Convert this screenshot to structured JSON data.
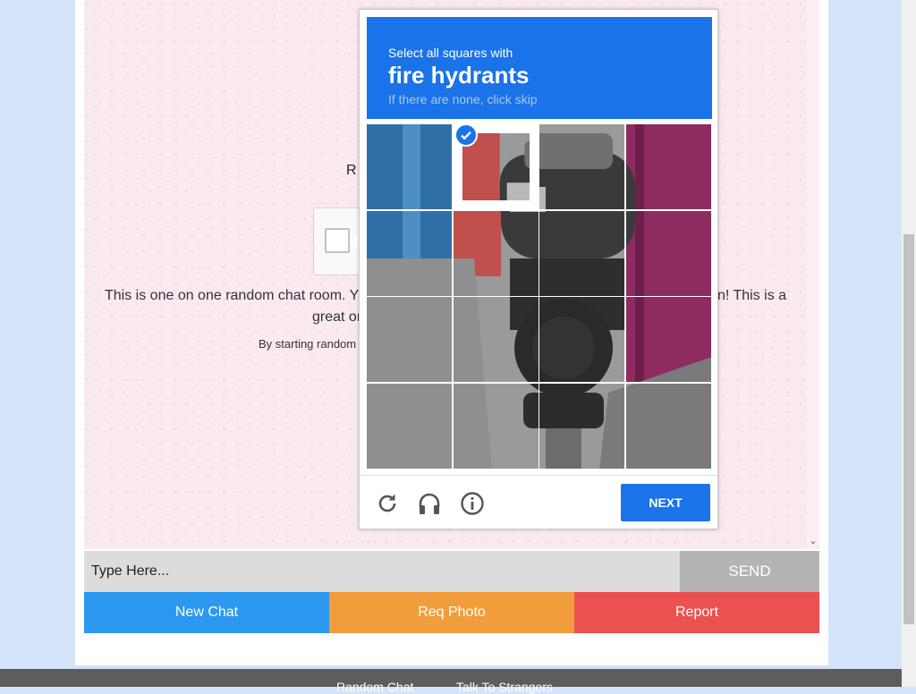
{
  "background_page": {
    "r_text": "R",
    "intro_left": "This is one on one random chat room. Y",
    "intro_right": "n! This is a",
    "intro_second": "great or",
    "intro_small": "By starting random"
  },
  "chat_input": {
    "placeholder": "Type Here...",
    "send_label": "SEND"
  },
  "action_buttons": {
    "new_chat": "New Chat",
    "req_photo": "Req Photo",
    "report": "Report"
  },
  "footer": {
    "link1": "Random Chat",
    "link2": "Talk To Strangers"
  },
  "captcha": {
    "instruction": "Select all squares with",
    "target": "fire hydrants",
    "hint": "If there are none, click skip",
    "grid_size": 4,
    "selected_tiles": [
      1
    ],
    "next_label": "NEXT",
    "controls": [
      "reload-icon",
      "audio-headphones-icon",
      "info-icon"
    ],
    "accent_color": "#1a73e8"
  },
  "colors": {
    "new_chat": "#2c98f0",
    "req_photo": "#f19d3b",
    "report": "#ec5151",
    "send": "#b4b4b4"
  }
}
